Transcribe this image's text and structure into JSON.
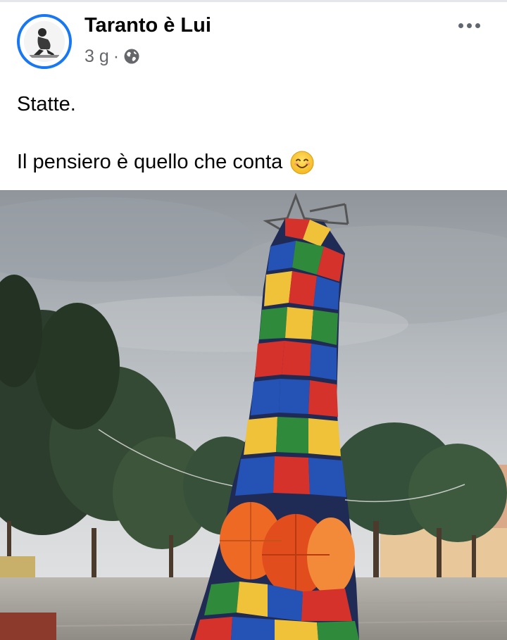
{
  "post": {
    "page_name": "Taranto è Lui",
    "time": "3 g",
    "separator": "·",
    "privacy_icon": "globe-icon",
    "more_icon": "more-options-icon",
    "text_line_1": "Statte.",
    "text_line_2": "Il pensiero è quello che conta",
    "text_emoji": "smiling-face-emoji"
  },
  "colors": {
    "avatar_ring": "#1877f2",
    "name_text": "#050505",
    "meta_text": "#65676b",
    "sky": "#c7cace",
    "umbrella_red": "#d6322c",
    "umbrella_blue": "#2452b5",
    "umbrella_yellow": "#f0c23a",
    "umbrella_green": "#2f8a3c",
    "umbrella_orange": "#ee6a24"
  }
}
